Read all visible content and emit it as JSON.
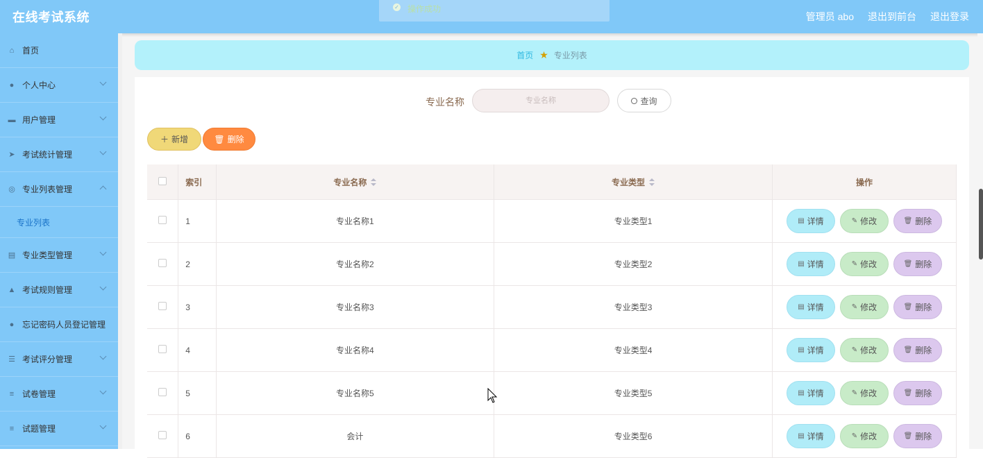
{
  "header": {
    "title": "在线考试系统",
    "toast": "操作成功",
    "user": "管理员 abo",
    "to_front": "退出到前台",
    "logout": "退出登录"
  },
  "sidebar": {
    "items": [
      {
        "label": "首页",
        "icon": "home-icon",
        "has_arrow": false
      },
      {
        "label": "个人中心",
        "icon": "user-icon",
        "has_arrow": true
      },
      {
        "label": "用户管理",
        "icon": "ticket-icon",
        "has_arrow": true
      },
      {
        "label": "考试统计管理",
        "icon": "send-icon",
        "has_arrow": true
      },
      {
        "label": "专业列表管理",
        "icon": "compass-icon",
        "has_arrow": true,
        "expanded": true
      },
      {
        "label": "专业类型管理",
        "icon": "clipboard-icon",
        "has_arrow": true
      },
      {
        "label": "考试规则管理",
        "icon": "thumb-icon",
        "has_arrow": true
      },
      {
        "label": "忘记密码人员登记管理",
        "icon": "person-icon",
        "has_arrow": false
      },
      {
        "label": "考试评分管理",
        "icon": "sliders-icon",
        "has_arrow": true
      },
      {
        "label": "试卷管理",
        "icon": "menu-icon",
        "has_arrow": true
      },
      {
        "label": "试题管理",
        "icon": "menu-icon",
        "has_arrow": true
      }
    ],
    "submenu": {
      "label": "专业列表"
    }
  },
  "breadcrumb": {
    "home": "首页",
    "current": "专业列表"
  },
  "search": {
    "label": "专业名称",
    "placeholder": "专业名称",
    "button": "查询"
  },
  "actions": {
    "add": "新增",
    "delete": "删除"
  },
  "table": {
    "headers": {
      "index": "索引",
      "name": "专业名称",
      "type": "专业类型",
      "ops": "操作"
    },
    "row_actions": {
      "detail": "详情",
      "edit": "修改",
      "delete": "删除"
    },
    "rows": [
      {
        "index": "1",
        "name": "专业名称1",
        "type": "专业类型1"
      },
      {
        "index": "2",
        "name": "专业名称2",
        "type": "专业类型2"
      },
      {
        "index": "3",
        "name": "专业名称3",
        "type": "专业类型3"
      },
      {
        "index": "4",
        "name": "专业名称4",
        "type": "专业类型4"
      },
      {
        "index": "5",
        "name": "专业名称5",
        "type": "专业类型5"
      },
      {
        "index": "6",
        "name": "会计",
        "type": "专业类型6"
      }
    ]
  }
}
